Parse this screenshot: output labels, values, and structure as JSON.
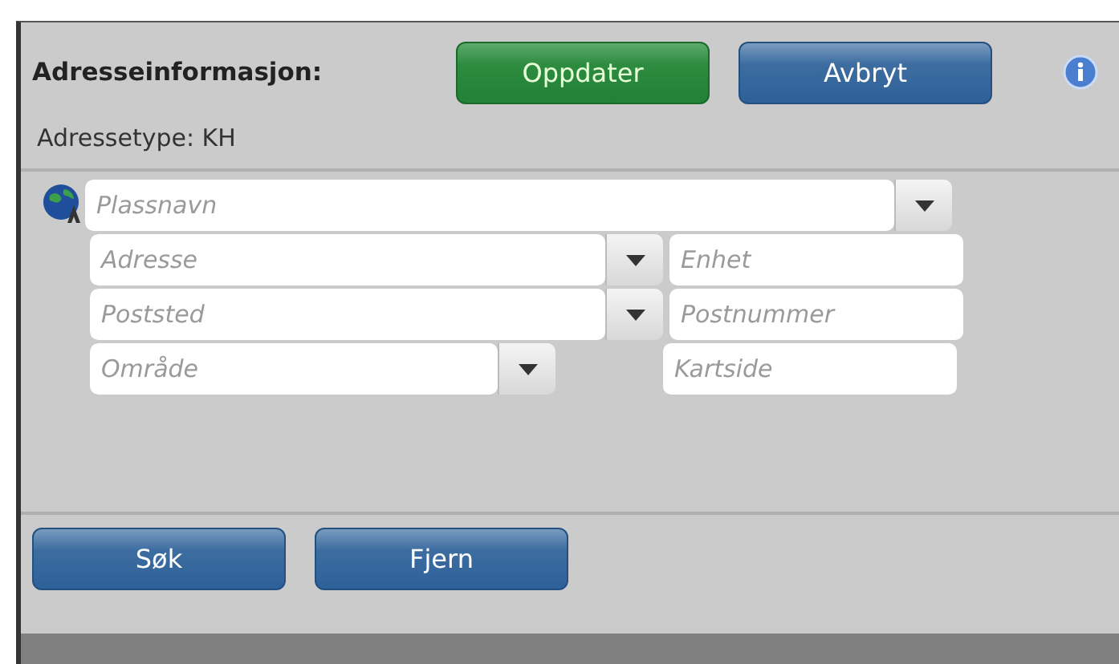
{
  "header": {
    "title": "Adresseinformasjon:",
    "buttons": [
      {
        "label": "Oppdater",
        "kind": "primary"
      },
      {
        "label": "Avbryt",
        "kind": "secondary"
      }
    ]
  },
  "address_type": "Adressetype: KH",
  "rows": [
    {
      "fields": [
        {
          "kind": "combo",
          "placeholder": "Plassnavn"
        }
      ]
    },
    {
      "fields": [
        {
          "kind": "combo",
          "placeholder": "Adresse"
        },
        {
          "kind": "text",
          "placeholder": "Enhet"
        }
      ]
    },
    {
      "fields": [
        {
          "kind": "combo",
          "placeholder": "Poststed"
        },
        {
          "kind": "text",
          "placeholder": "Postnummer"
        }
      ]
    },
    {
      "fields": [
        {
          "kind": "combo",
          "placeholder": "Område"
        },
        {
          "kind": "text",
          "placeholder": "Kartside"
        }
      ]
    }
  ],
  "footer_buttons": [
    {
      "label": "Søk"
    },
    {
      "label": "Fjern"
    }
  ]
}
